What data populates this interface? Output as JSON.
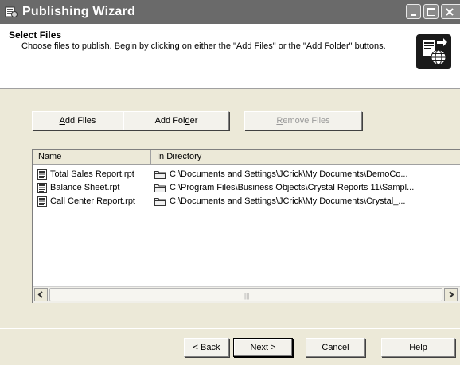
{
  "window": {
    "title": "Publishing Wizard",
    "icon": "wizard-app-icon",
    "controls": [
      "minimize-icon",
      "maximize-icon",
      "close-icon"
    ]
  },
  "header": {
    "title": "Select Files",
    "description": "Choose files to publish.  Begin by clicking on either the \"Add Files\" or the \"Add Folder\" buttons.",
    "graphic_icon": "publish-globe-icon"
  },
  "buttons": {
    "add_files": {
      "label": "Add Files",
      "mnemonic": "A",
      "rest": "dd Files"
    },
    "add_folder": {
      "pre": "Add Fol",
      "mnemonic": "d",
      "rest": "er",
      "label": "Add Folder"
    },
    "remove_files": {
      "mnemonic": "R",
      "rest": "emove Files",
      "label": "Remove Files",
      "enabled": false
    }
  },
  "file_list": {
    "columns": [
      "Name",
      "In Directory"
    ],
    "rows": [
      {
        "name": "Total Sales Report.rpt",
        "directory": "C:\\Documents and Settings\\JCrick\\My Documents\\DemoCo..."
      },
      {
        "name": "Balance Sheet.rpt",
        "directory": "C:\\Program Files\\Business Objects\\Crystal Reports 11\\Sampl..."
      },
      {
        "name": "Call Center Report.rpt",
        "directory": "C:\\Documents and Settings\\JCrick\\My Documents\\Crystal_..."
      }
    ],
    "scroll_grip": "|||"
  },
  "footer": {
    "back": {
      "pre": "< ",
      "mnemonic": "B",
      "rest": "ack"
    },
    "next": {
      "mnemonic": "N",
      "rest": "ext >"
    },
    "cancel": "Cancel",
    "help": "Help"
  },
  "colors": {
    "dialog_bg": "#ece9d8",
    "titlebar": "#6a6a6a",
    "disabled_text": "#9a9a9a"
  }
}
